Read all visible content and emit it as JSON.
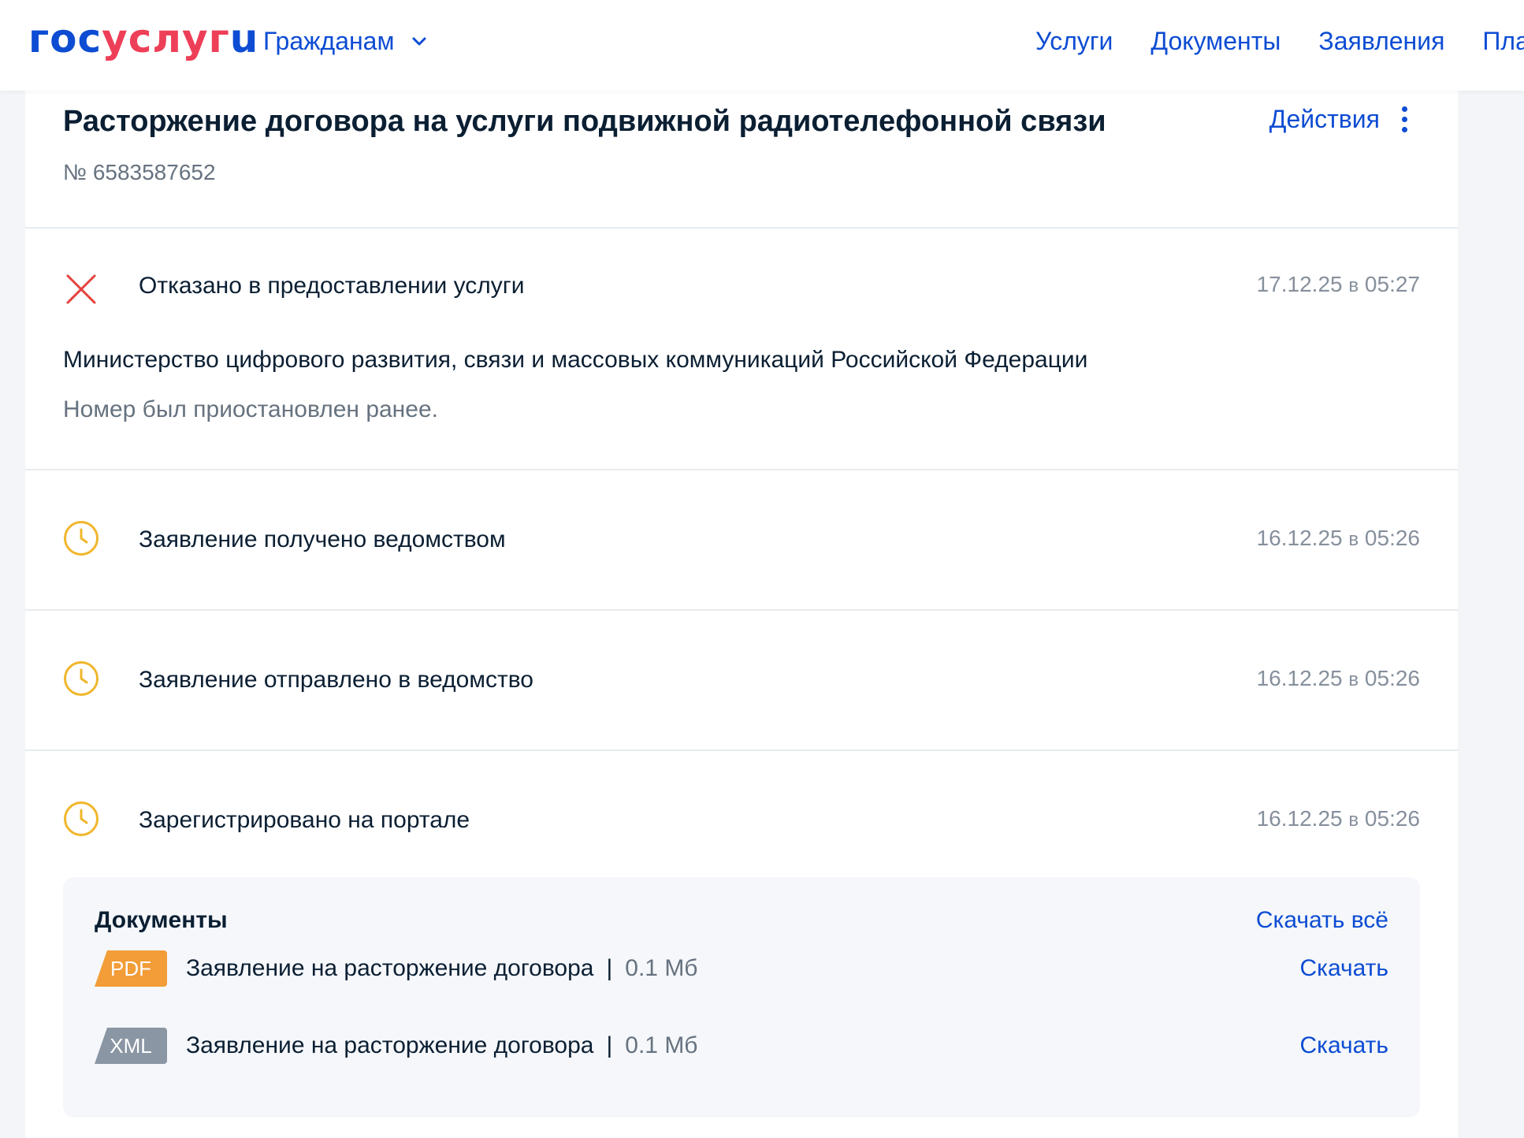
{
  "header": {
    "logo": {
      "part1": "гос",
      "part2": "услуг",
      "part3": "u"
    },
    "audience": "Гражданам",
    "nav": [
      "Услуги",
      "Документы",
      "Заявления",
      "Пла"
    ]
  },
  "application": {
    "title": "Расторжение договора на услуги подвижной радиотелефонной связи",
    "number": "№ 6583587652",
    "actions_label": "Действия"
  },
  "statuses": [
    {
      "icon": "cross-icon",
      "text": "Отказано в предоставлении услуги",
      "date": "17.12.25",
      "at": "в",
      "time": "05:27",
      "organization": "Министерство цифрового развития, связи и массовых коммуникаций Российской Федерации",
      "comment": "Номер был приостановлен ранее."
    },
    {
      "icon": "clock-icon",
      "text": "Заявление получено ведомством",
      "date": "16.12.25",
      "at": "в",
      "time": "05:26"
    },
    {
      "icon": "clock-icon",
      "text": "Заявление отправлено в ведомство",
      "date": "16.12.25",
      "at": "в",
      "time": "05:26"
    },
    {
      "icon": "clock-icon",
      "text": "Зарегистрировано на портале",
      "date": "16.12.25",
      "at": "в",
      "time": "05:26"
    }
  ],
  "documents": {
    "title": "Документы",
    "download_all": "Скачать всё",
    "items": [
      {
        "type": "PDF",
        "name": "Заявление на расторжение договора",
        "separator": "|",
        "size": "0.1 Мб",
        "download": "Скачать"
      },
      {
        "type": "XML",
        "name": "Заявление на расторжение договора",
        "separator": "|",
        "size": "0.1 Мб",
        "download": "Скачать"
      }
    ]
  },
  "colors": {
    "brand_blue": "#0d4cd3",
    "brand_red": "#ee3f58",
    "reject_red": "#e5413d",
    "pending_yellow": "#f0b62c",
    "pdf_orange": "#f29d38",
    "xml_gray": "#8a96a3"
  }
}
